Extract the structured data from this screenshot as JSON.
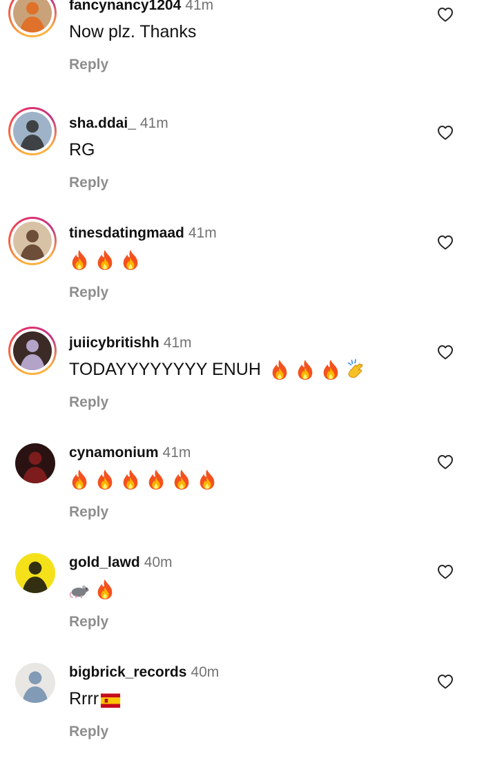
{
  "comments": [
    {
      "username": "fancynancy1204",
      "time": "41m",
      "text": "Now plz. Thanks",
      "emojis": [],
      "reply": "Reply",
      "avatar": {
        "ring": true,
        "bg": "#c9a27a",
        "fg": "#e4681c"
      }
    },
    {
      "username": "sha.ddai_",
      "time": "41m",
      "text": "RG",
      "emojis": [],
      "reply": "Reply",
      "avatar": {
        "ring": true,
        "bg": "#9fb3c8",
        "fg": "#2e2e2e"
      }
    },
    {
      "username": "tinesdatingmaad",
      "time": "41m",
      "text": "",
      "emojis": [
        "fire",
        "fire",
        "fire"
      ],
      "reply": "Reply",
      "avatar": {
        "ring": true,
        "bg": "#d8c2a6",
        "fg": "#5a3a24"
      }
    },
    {
      "username": "juiicybritishh",
      "time": "41m",
      "text": "TODAYYYYYYYY ENUH",
      "emojis": [
        "fire",
        "fire",
        "fire",
        "clap"
      ],
      "reply": "Reply",
      "avatar": {
        "ring": true,
        "bg": "#3b2a26",
        "fg": "#c9b8e6"
      }
    },
    {
      "username": "cynamonium",
      "time": "41m",
      "text": "",
      "emojis": [
        "fire",
        "fire",
        "fire",
        "fire",
        "fire",
        "fire"
      ],
      "reply": "Reply",
      "avatar": {
        "ring": false,
        "bg": "#2a1212",
        "fg": "#8b1e1e"
      }
    },
    {
      "username": "gold_lawd",
      "time": "40m",
      "text": "",
      "emojis": [
        "rat",
        "fire"
      ],
      "reply": "Reply",
      "avatar": {
        "ring": false,
        "bg": "#f5e11a",
        "fg": "#111111"
      }
    },
    {
      "username": "bigbrick_records",
      "time": "40m",
      "text": "Rrrr",
      "emojis": [
        "flag-es"
      ],
      "reply": "Reply",
      "avatar": {
        "ring": false,
        "bg": "#e9e7e3",
        "fg": "#6f8cae"
      }
    }
  ],
  "colors": {
    "accent_ring": "#e1306c",
    "muted": "#737373",
    "reply": "#8e8e8e"
  }
}
